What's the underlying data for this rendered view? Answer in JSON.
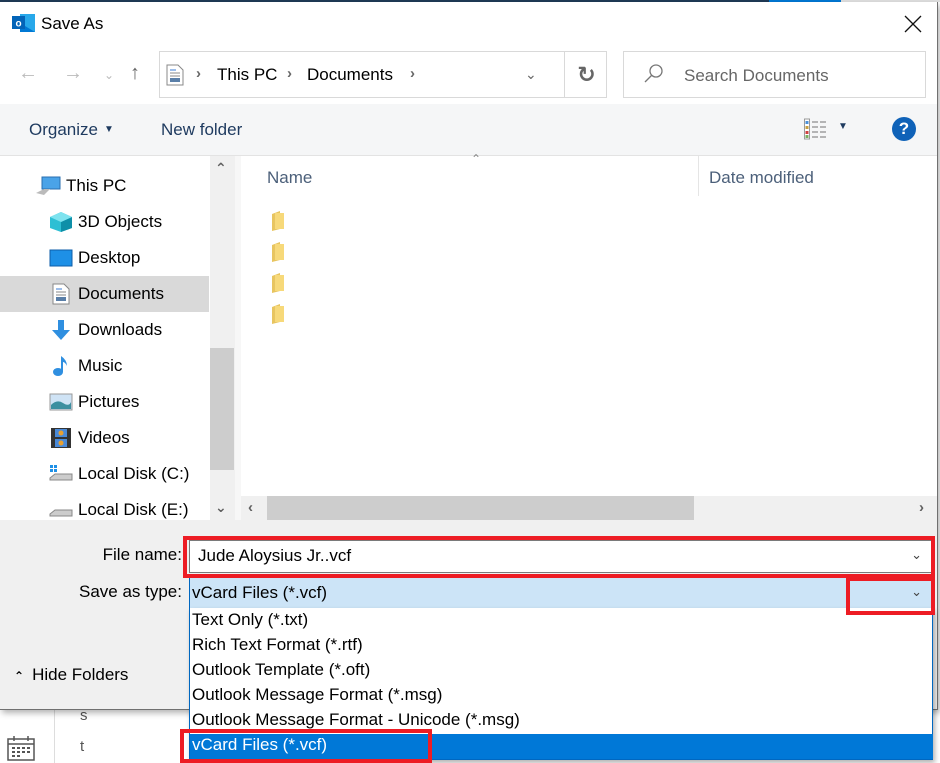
{
  "window": {
    "title": "Save As",
    "app_icon": "outlook-icon",
    "close_icon": "close-icon"
  },
  "navigation": {
    "back_icon": "arrow-left-icon",
    "forward_icon": "arrow-right-icon",
    "recent_icon": "chevron-down-icon",
    "up_icon": "arrow-up-icon",
    "breadcrumbs": [
      "This PC",
      "Documents"
    ],
    "refresh_icon": "refresh-icon",
    "search_placeholder": "Search Documents"
  },
  "toolbar": {
    "organize_label": "Organize",
    "new_folder_label": "New folder",
    "view_icon": "details-view-icon",
    "help_label": "?"
  },
  "sidebar": {
    "items": [
      {
        "label": "This PC",
        "icon": "computer-icon",
        "selected": false
      },
      {
        "label": "3D Objects",
        "icon": "cube-icon",
        "selected": false
      },
      {
        "label": "Desktop",
        "icon": "desktop-icon",
        "selected": false
      },
      {
        "label": "Documents",
        "icon": "document-icon",
        "selected": true
      },
      {
        "label": "Downloads",
        "icon": "download-arrow-icon",
        "selected": false
      },
      {
        "label": "Music",
        "icon": "music-note-icon",
        "selected": false
      },
      {
        "label": "Pictures",
        "icon": "picture-icon",
        "selected": false
      },
      {
        "label": "Videos",
        "icon": "video-film-icon",
        "selected": false
      },
      {
        "label": "Local Disk (C:)",
        "icon": "windows-drive-icon",
        "selected": false
      },
      {
        "label": "Local Disk (E:)",
        "icon": "drive-icon",
        "selected": false
      }
    ]
  },
  "filelist": {
    "columns": [
      "Name",
      "Date modified"
    ],
    "folder_count": 4
  },
  "form": {
    "filename_label": "File name:",
    "filename_value": "Jude Aloysius Jr..vcf",
    "savetype_label": "Save as type:",
    "savetype_value": "vCard Files (*.vcf)",
    "hide_folders_label": "Hide Folders"
  },
  "savetype_options": [
    {
      "label": "Text Only (*.txt)",
      "selected": false
    },
    {
      "label": "Rich Text Format (*.rtf)",
      "selected": false
    },
    {
      "label": "Outlook Template (*.oft)",
      "selected": false
    },
    {
      "label": "Outlook Message Format (*.msg)",
      "selected": false
    },
    {
      "label": "Outlook Message Format - Unicode (*.msg)",
      "selected": false
    },
    {
      "label": "vCard Files (*.vcf)",
      "selected": true
    }
  ],
  "background": {
    "letters": [
      "s",
      "t"
    ],
    "calendar_icon": "calendar-icon"
  },
  "annotations": {
    "highlight_color": "#ed1c24",
    "highlighted": [
      "filename-input",
      "savetype-dropdown-button",
      "option-vcard"
    ]
  }
}
